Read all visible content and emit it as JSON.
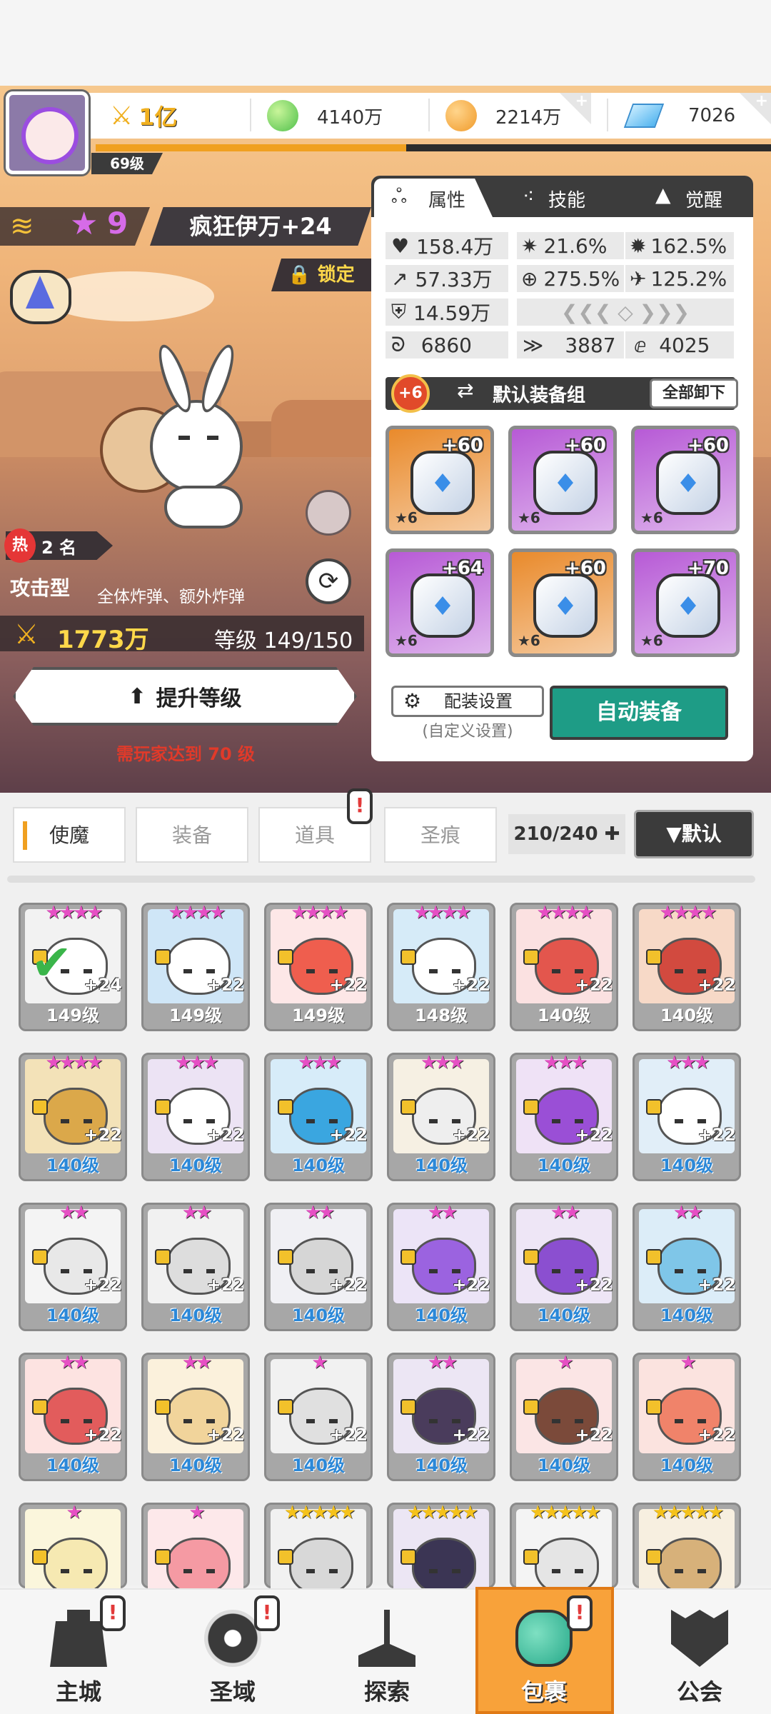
{
  "resources": {
    "power": "1亿",
    "green": "4140万",
    "coin": "2214万",
    "gem": "7026",
    "player_level": "69级",
    "xp_progress": 0.46
  },
  "hero": {
    "name": "疯狂伊万+24",
    "stars": "9",
    "lock": "锁定",
    "hot_badge": "热",
    "rank": "2 名",
    "type": "攻击型",
    "skill": "全体炸弹、额外炸弹",
    "power": "1773万",
    "grade": "等级 149/150",
    "upgrade_label": "提升等级",
    "requirement": "需玩家达到 70 级"
  },
  "panel": {
    "tabs": [
      "属性",
      "技能",
      "觉醒"
    ],
    "stats": {
      "hp": "158.4万",
      "crit": "21.6%",
      "crit_dmg": "162.5%",
      "atk": "57.33万",
      "acc": "275.5%",
      "speed": "125.2%",
      "def": "14.59万",
      "s1": "6860",
      "s2": "3887",
      "s3": "4025"
    },
    "equip_bonus": "+6",
    "equip_group": "默认装备组",
    "unequip_all": "全部卸下",
    "gear": [
      {
        "lvl": "+60",
        "star": "★6",
        "color": "#e98a2b",
        "icon": "sword-icon"
      },
      {
        "lvl": "+60",
        "star": "★6",
        "color": "#b75ad6",
        "icon": "helmet-icon"
      },
      {
        "lvl": "+60",
        "star": "★6",
        "color": "#b75ad6",
        "icon": "armor-icon"
      },
      {
        "lvl": "+64",
        "star": "★6",
        "color": "#b75ad6",
        "icon": "belt-icon"
      },
      {
        "lvl": "+60",
        "star": "★6",
        "color": "#e98a2b",
        "icon": "necklace-icon"
      },
      {
        "lvl": "+70",
        "star": "★6",
        "color": "#b75ad6",
        "icon": "boots-icon"
      }
    ],
    "loadout": "配装设置",
    "custom": "(自定义设置)",
    "auto_equip": "自动装备"
  },
  "inventory": {
    "tabs": [
      "使魔",
      "装备",
      "道具",
      "圣痕"
    ],
    "count": "210/240",
    "sort": "▼默认",
    "cards": [
      {
        "stars": "★★★★",
        "lvl": "149级",
        "plus": "+24",
        "bg": "#f2f2f2",
        "face": "#ffffff",
        "gold": false,
        "blue": false
      },
      {
        "stars": "★★★★",
        "lvl": "149级",
        "plus": "+22",
        "bg": "#cfe6f7",
        "face": "#ffffff",
        "gold": false,
        "blue": false
      },
      {
        "stars": "★★★★",
        "lvl": "149级",
        "plus": "+22",
        "bg": "#fde7e7",
        "face": "#ef5e4e",
        "gold": false,
        "blue": false
      },
      {
        "stars": "★★★★",
        "lvl": "148级",
        "plus": "+22",
        "bg": "#d6ebf8",
        "face": "#ffffff",
        "gold": false,
        "blue": false
      },
      {
        "stars": "★★★★",
        "lvl": "140级",
        "plus": "+22",
        "bg": "#fbe1e1",
        "face": "#e3564d",
        "gold": false,
        "blue": false
      },
      {
        "stars": "★★★★",
        "lvl": "140级",
        "plus": "+22",
        "bg": "#f7d9c7",
        "face": "#d24a3f",
        "gold": false,
        "blue": false
      },
      {
        "stars": "★★★★",
        "lvl": "140级",
        "plus": "+22",
        "bg": "#f3e2b8",
        "face": "#dba84a",
        "gold": false,
        "blue": true
      },
      {
        "stars": "★★★",
        "lvl": "140级",
        "plus": "+22",
        "bg": "#ece3f4",
        "face": "#ffffff",
        "gold": false,
        "blue": true
      },
      {
        "stars": "★★★",
        "lvl": "140级",
        "plus": "+22",
        "bg": "#d7ecf9",
        "face": "#3aa6e0",
        "gold": false,
        "blue": true
      },
      {
        "stars": "★★★",
        "lvl": "140级",
        "plus": "+22",
        "bg": "#f6f0e3",
        "face": "#eeeeee",
        "gold": false,
        "blue": true
      },
      {
        "stars": "★★★",
        "lvl": "140级",
        "plus": "+22",
        "bg": "#efe2f6",
        "face": "#9a4fd6",
        "gold": false,
        "blue": true
      },
      {
        "stars": "★★★",
        "lvl": "140级",
        "plus": "+22",
        "bg": "#e1eef8",
        "face": "#ffffff",
        "gold": false,
        "blue": true
      },
      {
        "stars": "★★",
        "lvl": "140级",
        "plus": "+22",
        "bg": "#f4f4f4",
        "face": "#e8e8e8",
        "gold": false,
        "blue": true
      },
      {
        "stars": "★★",
        "lvl": "140级",
        "plus": "+22",
        "bg": "#f1f1f1",
        "face": "#dddddd",
        "gold": false,
        "blue": true
      },
      {
        "stars": "★★",
        "lvl": "140级",
        "plus": "+22",
        "bg": "#f0f0f4",
        "face": "#d6d6d6",
        "gold": false,
        "blue": true
      },
      {
        "stars": "★★",
        "lvl": "140级",
        "plus": "+22",
        "bg": "#ece4f7",
        "face": "#9b63e0",
        "gold": false,
        "blue": true
      },
      {
        "stars": "★★",
        "lvl": "140级",
        "plus": "+22",
        "bg": "#eee6f6",
        "face": "#8b4fd0",
        "gold": false,
        "blue": true
      },
      {
        "stars": "★★",
        "lvl": "140级",
        "plus": "+22",
        "bg": "#dcedf8",
        "face": "#7fc6e8",
        "gold": false,
        "blue": true
      },
      {
        "stars": "★★",
        "lvl": "140级",
        "plus": "+22",
        "bg": "#fde3e1",
        "face": "#e25c5c",
        "gold": false,
        "blue": true
      },
      {
        "stars": "★★",
        "lvl": "140级",
        "plus": "+22",
        "bg": "#fbf1dc",
        "face": "#f1d49b",
        "gold": false,
        "blue": true
      },
      {
        "stars": "★",
        "lvl": "140级",
        "plus": "+22",
        "bg": "#f1f1f1",
        "face": "#e0e0e0",
        "gold": false,
        "blue": true
      },
      {
        "stars": "★★",
        "lvl": "140级",
        "plus": "+22",
        "bg": "#ece6f4",
        "face": "#4a3c5c",
        "gold": false,
        "blue": true
      },
      {
        "stars": "★",
        "lvl": "140级",
        "plus": "+22",
        "bg": "#fbe5e5",
        "face": "#7b4a3a",
        "gold": false,
        "blue": true
      },
      {
        "stars": "★",
        "lvl": "140级",
        "plus": "+22",
        "bg": "#fbe3df",
        "face": "#f0836a",
        "gold": false,
        "blue": true
      },
      {
        "stars": "★",
        "lvl": "",
        "plus": "",
        "bg": "#fbf6dc",
        "face": "#f6e9b2",
        "gold": false,
        "blue": true
      },
      {
        "stars": "★",
        "lvl": "",
        "plus": "",
        "bg": "#fde8ea",
        "face": "#f59aa3",
        "gold": false,
        "blue": true
      },
      {
        "stars": "★★★★★",
        "lvl": "",
        "plus": "",
        "bg": "#f1f1f1",
        "face": "#d8d8d8",
        "gold": true,
        "blue": true
      },
      {
        "stars": "★★★★★",
        "lvl": "",
        "plus": "",
        "bg": "#ece6f4",
        "face": "#3b3554",
        "gold": true,
        "blue": true
      },
      {
        "stars": "★★★★★",
        "lvl": "",
        "plus": "",
        "bg": "#f4f4f4",
        "face": "#e5e5e5",
        "gold": true,
        "blue": true
      },
      {
        "stars": "★★★★★",
        "lvl": "",
        "plus": "",
        "bg": "#f7efe0",
        "face": "#d7b17a",
        "gold": true,
        "blue": true
      }
    ]
  },
  "nav": {
    "items": [
      "主城",
      "圣域",
      "探索",
      "包裹",
      "公会"
    ],
    "badge": "!"
  },
  "colors": {
    "accent_orange": "#f0a020",
    "accent_teal": "#1e9c86",
    "purple_rarity": "#b75ad6",
    "orange_rarity": "#e98a2b"
  }
}
